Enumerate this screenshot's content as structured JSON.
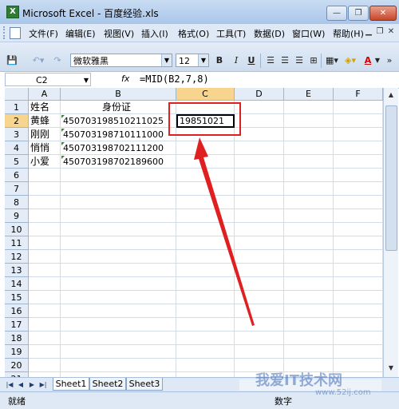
{
  "window": {
    "title": "Microsoft Excel - 百度经验.xls",
    "minimize_label": "—",
    "restore_label": "❐",
    "close_label": "✕"
  },
  "menu": {
    "items": [
      "文件(F)",
      "编辑(E)",
      "视图(V)",
      "插入(I)",
      "格式(O)",
      "工具(T)",
      "数据(D)",
      "窗口(W)",
      "帮助(H)"
    ]
  },
  "toolbar": {
    "font_name": "微软雅黑",
    "font_size": "12",
    "bold": "B",
    "italic": "I",
    "underline": "U",
    "font_color_label": "A"
  },
  "formula_bar": {
    "name_box": "C2",
    "fx_label": "fx",
    "formula": "=MID(B2,7,8)"
  },
  "grid": {
    "columns": [
      "A",
      "B",
      "C",
      "D",
      "E",
      "F"
    ],
    "rows": [
      "1",
      "2",
      "3",
      "4",
      "5",
      "6",
      "7",
      "8",
      "9",
      "10",
      "11",
      "12",
      "13",
      "14",
      "15",
      "16",
      "17",
      "18",
      "19",
      "20",
      "21"
    ],
    "cells": {
      "A1": "姓名",
      "B1": "身份证",
      "A2": "黄蜂",
      "B2": "450703198510211025",
      "C2": "19851021",
      "A3": "刚刚",
      "B3": "450703198710111000",
      "A4": "悄悄",
      "B4": "450703198702111200",
      "A5": "小爱",
      "B5": "450703198702189600"
    },
    "selected_cell": "C2"
  },
  "sheets": {
    "tabs": [
      "Sheet1",
      "Sheet2",
      "Sheet3"
    ],
    "active": "Sheet1"
  },
  "status": {
    "left": "就绪",
    "mode": "数字"
  },
  "colors": {
    "annotation": "#e02020",
    "header_selected": "#f8d58e",
    "header_bg": "#e4ecf7"
  },
  "watermark": {
    "text": "我爱IT技术网",
    "url": "www.52ij.com"
  }
}
